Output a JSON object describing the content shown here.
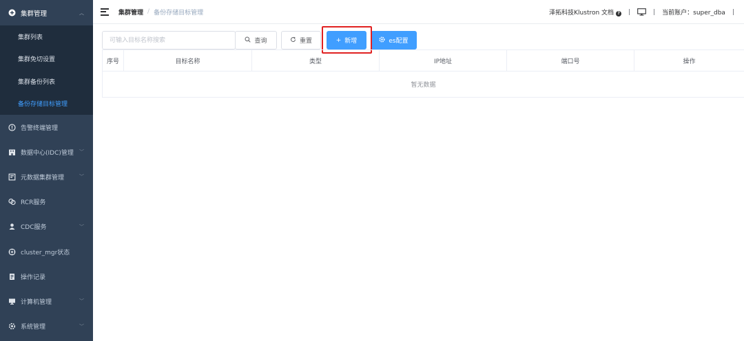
{
  "sidebar": {
    "group": {
      "label": "集群管理",
      "items": [
        {
          "label": "集群列表",
          "active": false
        },
        {
          "label": "集群免切设置",
          "active": false
        },
        {
          "label": "集群备份列表",
          "active": false
        },
        {
          "label": "备份存储目标管理",
          "active": true
        }
      ]
    },
    "items": [
      {
        "label": "告警终端管理",
        "icon": "info-circle-icon",
        "has_children": false
      },
      {
        "label": "数据中心(IDC)管理",
        "icon": "building-icon",
        "has_children": true
      },
      {
        "label": "元数据集群管理",
        "icon": "database-icon",
        "has_children": true
      },
      {
        "label": "RCR服务",
        "icon": "link-icon",
        "has_children": false
      },
      {
        "label": "CDC服务",
        "icon": "user-icon",
        "has_children": true
      },
      {
        "label": "cluster_mgr状态",
        "icon": "gear-wheel-icon",
        "has_children": false
      },
      {
        "label": "操作记录",
        "icon": "document-icon",
        "has_children": false
      },
      {
        "label": "计算机管理",
        "icon": "monitor-icon",
        "has_children": true
      },
      {
        "label": "系统管理",
        "icon": "settings-icon",
        "has_children": true
      }
    ]
  },
  "header": {
    "breadcrumb_root": "集群管理",
    "breadcrumb_separator": "/",
    "breadcrumb_current": "备份存储目标管理",
    "docs_link": "泽拓科技Klustron 文档",
    "account_label": "当前账户：super_dba"
  },
  "toolbar": {
    "search_placeholder": "可输入目标名称搜索",
    "search_value": "",
    "query_label": "查询",
    "reset_label": "重置",
    "add_label": "新增",
    "es_label": "es配置"
  },
  "table": {
    "columns": [
      {
        "label": "序号"
      },
      {
        "label": "目标名称"
      },
      {
        "label": "类型"
      },
      {
        "label": "IP地址"
      },
      {
        "label": "端口号"
      },
      {
        "label": "操作"
      }
    ],
    "empty_text": "暂无数据"
  },
  "colors": {
    "sidebar_bg": "#304156",
    "submenu_bg": "#1f2d3d",
    "accent": "#409eff",
    "highlight": "#e02020"
  }
}
